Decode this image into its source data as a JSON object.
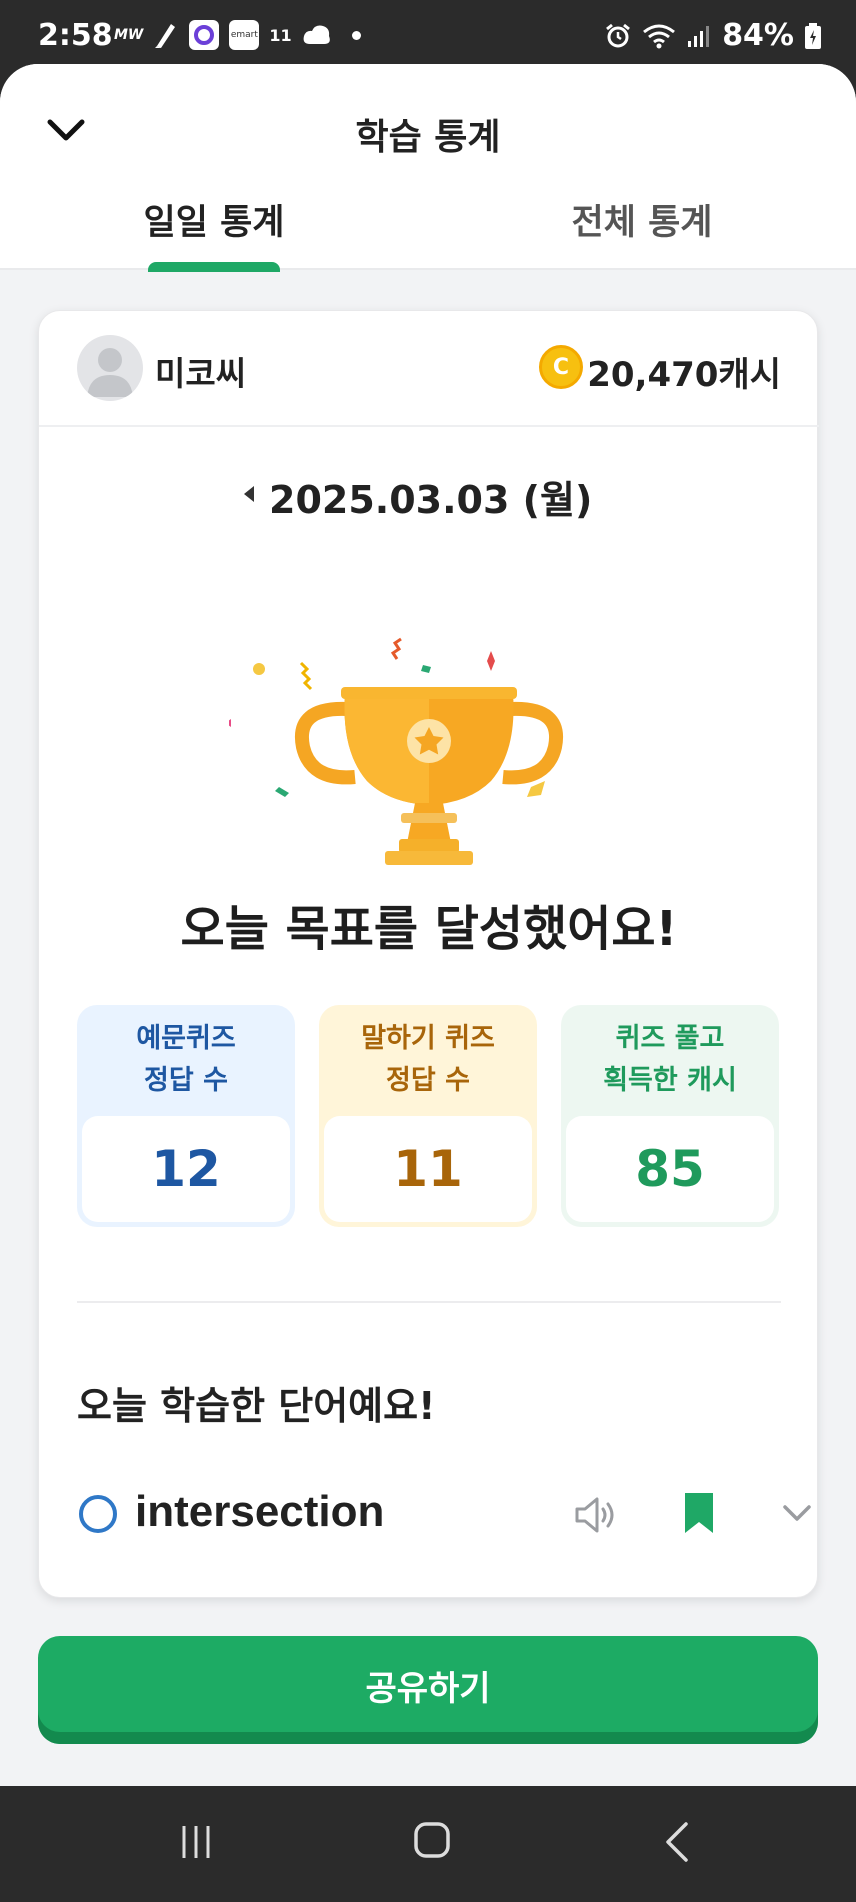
{
  "status_bar": {
    "time": "2:58",
    "carrier_label": "MW",
    "emart_label": "emart",
    "eleven_label": "11",
    "battery": "84%",
    "icons": [
      "notification-app-icon",
      "alarm-icon",
      "wifi-icon",
      "signal-icon",
      "battery-icon"
    ]
  },
  "header": {
    "title": "학습 통계",
    "tabs": [
      {
        "label": "일일 통계",
        "active": true
      },
      {
        "label": "전체 통계",
        "active": false
      }
    ]
  },
  "profile": {
    "username": "미코씨",
    "cash": "20,470캐시",
    "coin_symbol": "C"
  },
  "date": {
    "text": "2025.03.03 (월)"
  },
  "goal": {
    "message": "오늘 목표를 달성했어요!"
  },
  "stats": [
    {
      "line1": "예문퀴즈",
      "line2": "정답 수",
      "value": "12"
    },
    {
      "line1": "말하기 퀴즈",
      "line2": "정답 수",
      "value": "11"
    },
    {
      "line1": "퀴즈 풀고",
      "line2": "획득한 캐시",
      "value": "85"
    }
  ],
  "words_section": {
    "title": "오늘 학습한 단어예요!",
    "words": [
      {
        "word": "intersection",
        "bookmarked": true
      }
    ]
  },
  "share_button": {
    "label": "공유하기"
  },
  "colors": {
    "accent": "#1fa866",
    "stat_blue": "#1e57a2",
    "stat_orange": "#a8650a",
    "stat_green": "#1f9a5c"
  }
}
